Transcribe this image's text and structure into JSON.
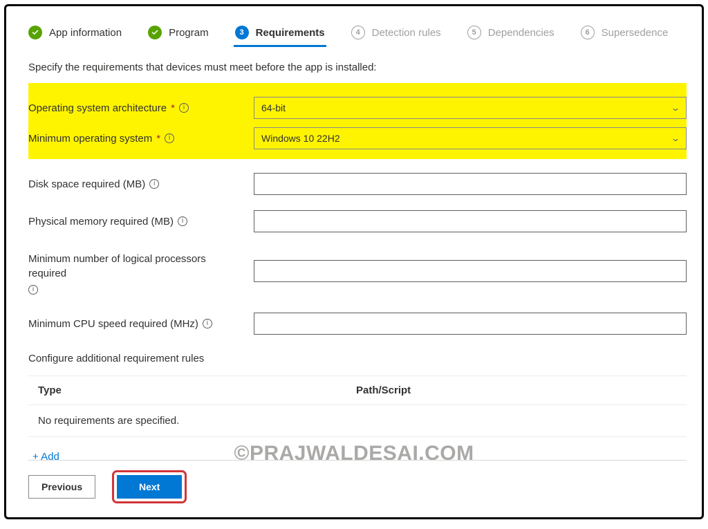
{
  "steps": {
    "s1": "App information",
    "s2": "Program",
    "s3": "Requirements",
    "s4": "Detection rules",
    "s5": "Dependencies",
    "s6": "Supersedence",
    "n3": "3",
    "n4": "4",
    "n5": "5",
    "n6": "6"
  },
  "intro": "Specify the requirements that devices must meet before the app is installed:",
  "fields": {
    "osarch": {
      "label": "Operating system architecture",
      "value": "64-bit"
    },
    "minos": {
      "label": "Minimum operating system",
      "value": "Windows 10 22H2"
    },
    "disk": {
      "label": "Disk space required (MB)"
    },
    "mem": {
      "label": "Physical memory required (MB)"
    },
    "cpus": {
      "label": "Minimum number of logical processors required"
    },
    "cpuspeed": {
      "label": "Minimum CPU speed required (MHz)"
    }
  },
  "rules": {
    "heading": "Configure additional requirement rules",
    "col_type": "Type",
    "col_path": "Path/Script",
    "empty": "No requirements are specified.",
    "add": "+ Add"
  },
  "buttons": {
    "prev": "Previous",
    "next": "Next"
  },
  "required_mark": "*",
  "watermark": "©PRAJWALDESAI.COM"
}
